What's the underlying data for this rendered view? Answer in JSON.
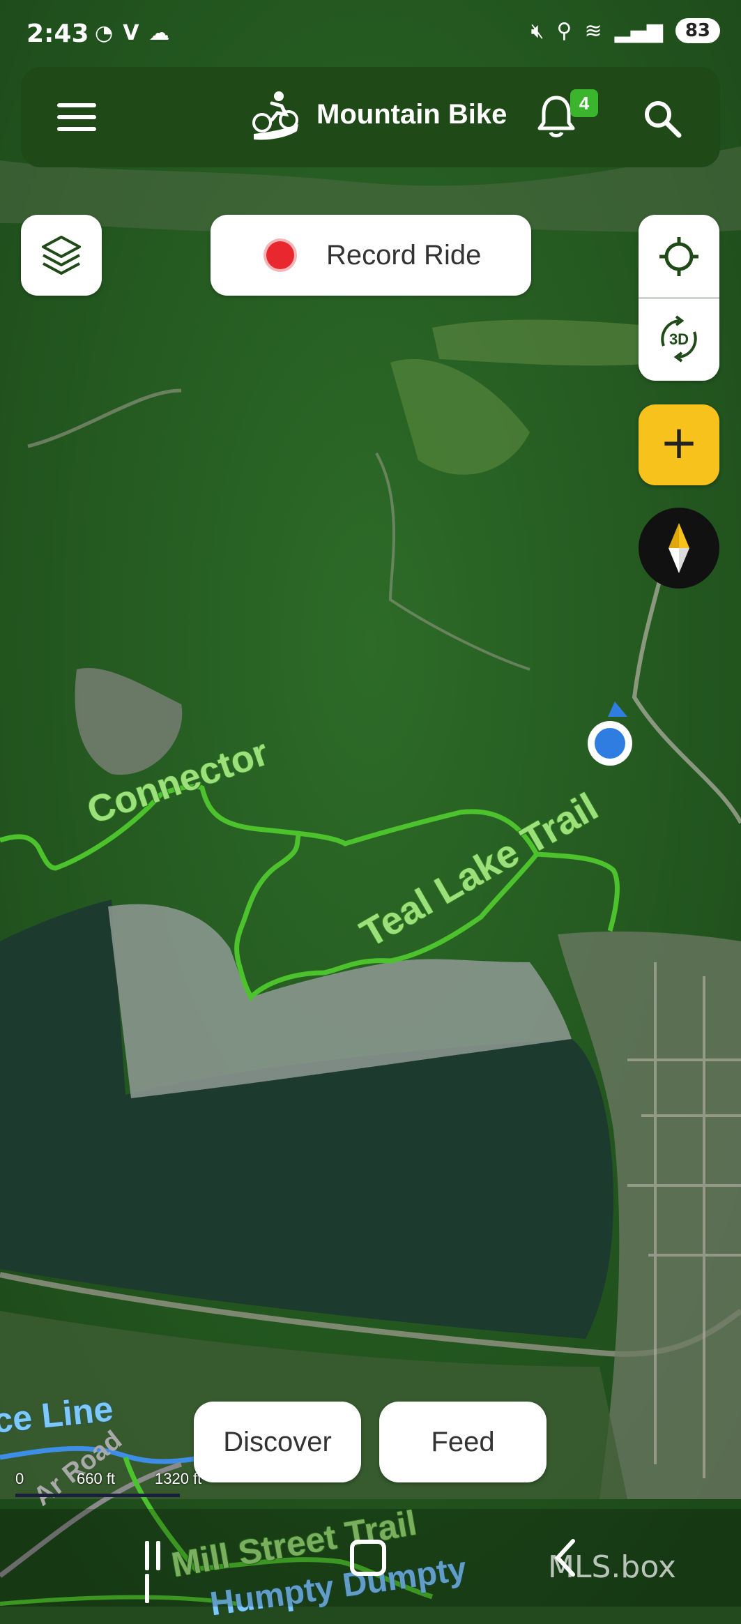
{
  "status_bar": {
    "time": "2:43",
    "app_icons": [
      "messenger-icon",
      "verizon-icon",
      "chat-icon"
    ],
    "system_icons": [
      "mute-vibrate-icon",
      "location-icon",
      "wifi-icon",
      "signal-icon"
    ],
    "battery": "83"
  },
  "header": {
    "activity_label": "Mountain Bike",
    "notification_count": "4"
  },
  "record": {
    "label": "Record Ride"
  },
  "map_controls": {
    "view3d_label": "3D",
    "add_label": "+"
  },
  "trails": {
    "connector": "Connector",
    "teal_lake": "Teal Lake Trail",
    "blue_line": "ce Line",
    "road": "Ar Road",
    "mill_street": "Mill Street Trail",
    "humpty": "Humpty Dumpty"
  },
  "scale": {
    "label_0": "0",
    "label_1": "660 ft",
    "label_2": "1320 ft"
  },
  "bottom_tabs": {
    "discover": "Discover",
    "feed": "Feed"
  },
  "watermark": "MLS.box",
  "colors": {
    "header_bg": "#1f4a17",
    "accent_green": "#3cb52e",
    "record_red": "#e8282e",
    "add_yellow": "#f6c21b",
    "trail_green": "#4cc22c",
    "user_blue": "#2f7de1"
  }
}
